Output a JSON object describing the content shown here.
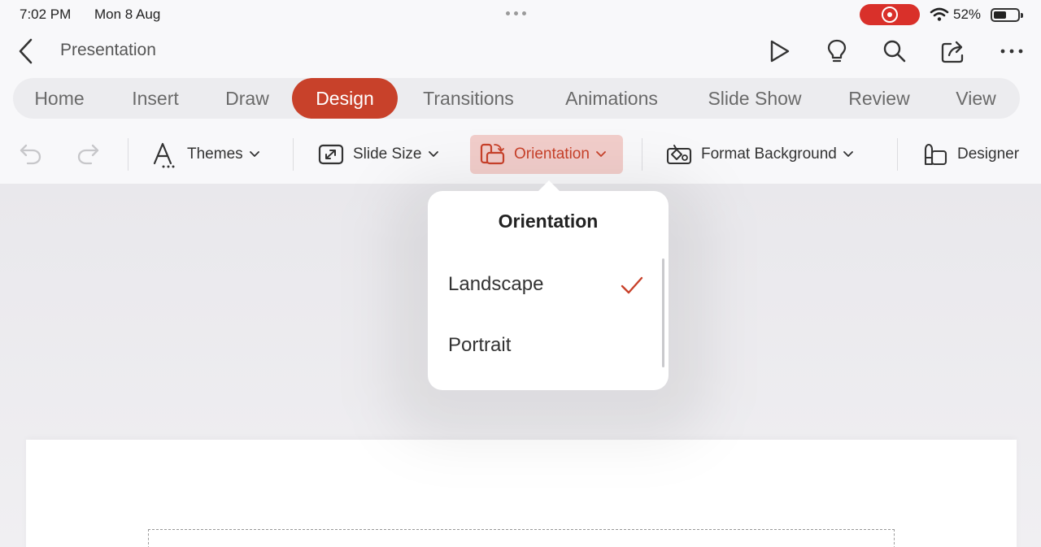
{
  "status_bar": {
    "time": "7:02 PM",
    "date": "Mon 8 Aug",
    "battery": "52%"
  },
  "title_bar": {
    "document_title": "Presentation"
  },
  "tabs": [
    {
      "label": "Home"
    },
    {
      "label": "Insert"
    },
    {
      "label": "Draw"
    },
    {
      "label": "Design",
      "active": true
    },
    {
      "label": "Transitions"
    },
    {
      "label": "Animations"
    },
    {
      "label": "Slide Show"
    },
    {
      "label": "Review"
    },
    {
      "label": "View"
    }
  ],
  "ribbon": {
    "themes": "Themes",
    "slide_size": "Slide Size",
    "orientation": "Orientation",
    "format_background": "Format Background",
    "designer": "Designer"
  },
  "popover": {
    "title": "Orientation",
    "options": [
      {
        "label": "Landscape",
        "selected": true
      },
      {
        "label": "Portrait",
        "selected": false
      }
    ]
  },
  "colors": {
    "accent": "#c8412a",
    "accent_soft": "#f1cdca",
    "recording": "#d9302a"
  }
}
